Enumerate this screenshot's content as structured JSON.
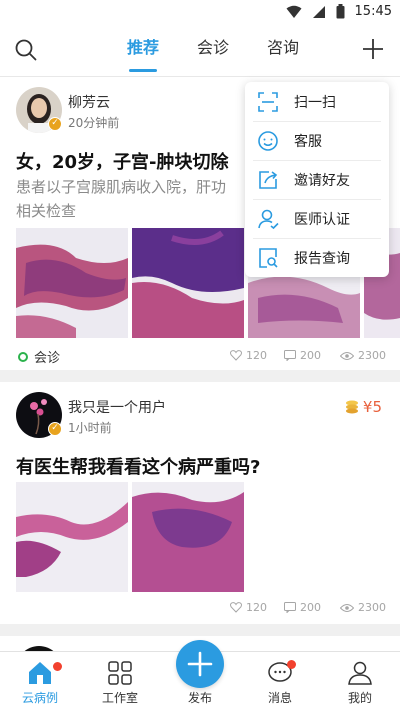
{
  "status_bar": {
    "time": "15:45"
  },
  "header": {
    "tabs": [
      {
        "label": "推荐",
        "active": true
      },
      {
        "label": "会诊",
        "active": false
      },
      {
        "label": "咨询",
        "active": false
      }
    ]
  },
  "menu": {
    "items": [
      {
        "label": "扫一扫",
        "icon": "scan-icon"
      },
      {
        "label": "客服",
        "icon": "customer-service-icon"
      },
      {
        "label": "邀请好友",
        "icon": "invite-icon"
      },
      {
        "label": "医师认证",
        "icon": "doctor-verify-icon"
      },
      {
        "label": "报告查询",
        "icon": "report-search-icon"
      }
    ]
  },
  "feed": [
    {
      "name": "柳芳云",
      "time": "20分钟前",
      "title": "女，20岁，子宫-肿块切除",
      "summary": "患者以子宫腺肌病收入院，肝功",
      "summary_line2": "相关检查",
      "tag": "会诊",
      "likes": "120",
      "comments": "200",
      "views": "2300"
    },
    {
      "name": "我只是一个用户",
      "time": "1小时前",
      "title": "有医生帮我看看这个病严重吗?",
      "reward": "¥5",
      "likes": "120",
      "comments": "200",
      "views": "2300"
    }
  ],
  "bottom_nav": {
    "items": [
      {
        "label": "云病例",
        "active": true
      },
      {
        "label": "工作室"
      },
      {
        "label": "发布"
      },
      {
        "label": "消息"
      },
      {
        "label": "我的"
      }
    ]
  },
  "colors": {
    "accent": "#2b9be0",
    "consult_green": "#2bb24c",
    "reward_orange": "#e8603c",
    "red_dot": "#f2412e"
  }
}
